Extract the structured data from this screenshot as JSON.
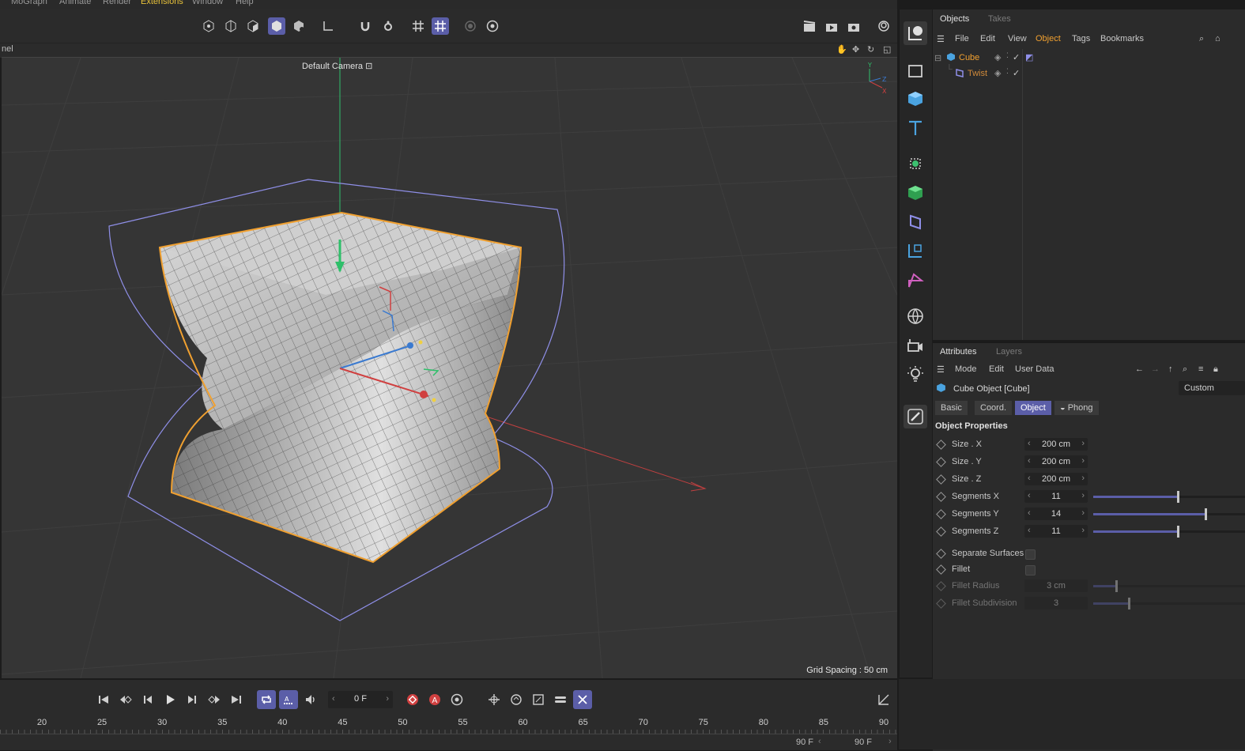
{
  "menu": [
    "MoGraph",
    "Animate",
    "Render",
    "Extensions",
    "Window",
    "Help"
  ],
  "panel_label": "nel",
  "viewport": {
    "camera_label": "Default Camera",
    "grid_spacing": "Grid Spacing : 50 cm"
  },
  "objects_manager": {
    "tabs": [
      "Objects",
      "Takes"
    ],
    "menu": [
      "File",
      "Edit",
      "View",
      "Object",
      "Tags",
      "Bookmarks"
    ],
    "tree": [
      {
        "name": "Cube",
        "color": "#f0a030"
      },
      {
        "name": "Twist",
        "color": "#d08a3a"
      }
    ]
  },
  "attributes": {
    "tabs": [
      "Attributes",
      "Layers"
    ],
    "menu": [
      "Mode",
      "Edit",
      "User Data"
    ],
    "object_title": "Cube Object [Cube]",
    "preset": "Custom",
    "prop_tabs": [
      "Basic",
      "Coord.",
      "Object",
      "Phong"
    ],
    "section": "Object Properties",
    "props": [
      {
        "label": "Size . X",
        "value": "200 cm"
      },
      {
        "label": "Size . Y",
        "value": "200 cm"
      },
      {
        "label": "Size . Z",
        "value": "200 cm"
      },
      {
        "label": "Segments X",
        "value": "11",
        "slider": 0.55
      },
      {
        "label": "Segments Y",
        "value": "14",
        "slider": 0.73
      },
      {
        "label": "Segments Z",
        "value": "11",
        "slider": 0.55
      }
    ],
    "checks": [
      {
        "label": "Separate Surfaces"
      },
      {
        "label": "Fillet"
      }
    ],
    "disabled": [
      {
        "label": "Fillet Radius",
        "value": "3 cm",
        "slider": 0.15
      },
      {
        "label": "Fillet Subdivision",
        "value": "3",
        "slider": 0.23
      }
    ]
  },
  "timeline": {
    "current_frame": "0 F",
    "ruler": [
      "20",
      "25",
      "30",
      "35",
      "40",
      "45",
      "50",
      "55",
      "60",
      "65",
      "70",
      "75",
      "80",
      "85",
      "90"
    ],
    "end_frame_a": "90 F",
    "end_frame_b": "90 F"
  },
  "colors": {
    "accent": "#5b5ea8",
    "selection": "#f0a030"
  }
}
